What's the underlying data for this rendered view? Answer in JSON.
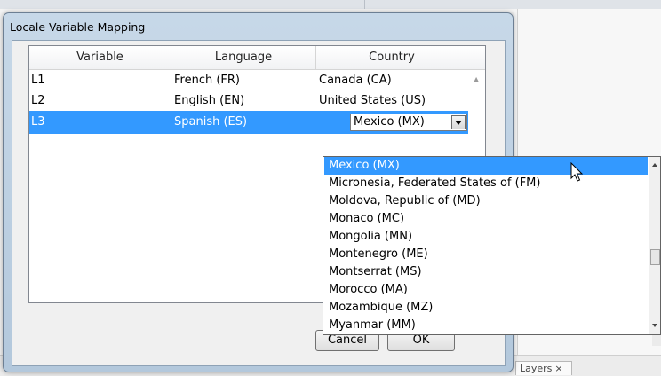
{
  "background": {
    "tab_label": "Layers",
    "tab_close": "×"
  },
  "dialog": {
    "title": "Locale Variable Mapping",
    "columns": [
      "Variable",
      "Language",
      "Country"
    ],
    "rows": [
      {
        "variable": "L1",
        "language": "French (FR)",
        "country": "Canada (CA)",
        "selected": false
      },
      {
        "variable": "L2",
        "language": "English (EN)",
        "country": "United States (US)",
        "selected": false
      },
      {
        "variable": "L3",
        "language": "Spanish (ES)",
        "country": "Mexico (MX)",
        "selected": true
      }
    ],
    "buttons": {
      "cancel": "Cancel",
      "ok": "OK"
    }
  },
  "country_dropdown": {
    "selected_value": "Mexico (MX)",
    "options": [
      "Mexico (MX)",
      "Micronesia, Federated States of (FM)",
      "Moldova, Republic of (MD)",
      "Monaco (MC)",
      "Mongolia (MN)",
      "Montenegro (ME)",
      "Montserrat (MS)",
      "Morocco (MA)",
      "Mozambique (MZ)",
      "Myanmar (MM)"
    ],
    "highlighted_index": 0
  },
  "colors": {
    "selection": "#3399ff",
    "selection_text": "#ffffff"
  },
  "icons": {
    "cursor": "arrow-cursor-icon",
    "combo_arrow": "chevron-down-icon"
  }
}
